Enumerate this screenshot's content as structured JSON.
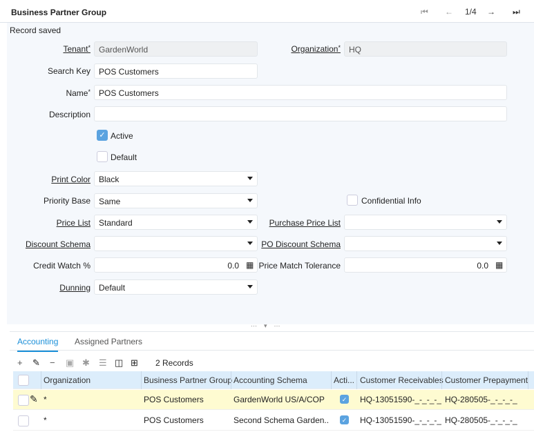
{
  "header": {
    "title": "Business Partner Group",
    "record_position": "1/4"
  },
  "status": "Record saved",
  "form": {
    "tenant": {
      "label": "Tenant",
      "value": "GardenWorld"
    },
    "organization": {
      "label": "Organization",
      "value": "HQ"
    },
    "search_key": {
      "label": "Search Key",
      "value": "POS Customers"
    },
    "name": {
      "label": "Name",
      "value": "POS Customers"
    },
    "description": {
      "label": "Description",
      "value": ""
    },
    "active": {
      "label": "Active",
      "checked": true
    },
    "default": {
      "label": "Default",
      "checked": false
    },
    "print_color": {
      "label": "Print Color",
      "value": "Black"
    },
    "priority_base": {
      "label": "Priority Base",
      "value": "Same"
    },
    "confidential_info": {
      "label": "Confidential Info",
      "checked": false
    },
    "price_list": {
      "label": "Price List",
      "value": "Standard"
    },
    "purchase_price_list": {
      "label": "Purchase Price List",
      "value": ""
    },
    "discount_schema": {
      "label": "Discount Schema",
      "value": ""
    },
    "po_discount_schema": {
      "label": "PO Discount Schema",
      "value": ""
    },
    "credit_watch": {
      "label": "Credit Watch %",
      "value": "0.0"
    },
    "price_match_tolerance": {
      "label": "Price Match Tolerance",
      "value": "0.0"
    },
    "dunning": {
      "label": "Dunning",
      "value": "Default"
    },
    "required_mark": "*"
  },
  "tabs": [
    {
      "label": "Accounting"
    },
    {
      "label": "Assigned Partners"
    }
  ],
  "toolbar": {
    "record_count": "2 Records"
  },
  "grid": {
    "columns": [
      "Organization",
      "Business Partner Group",
      "Accounting Schema",
      "Acti...",
      "Customer Receivables",
      "Customer Prepayment"
    ],
    "rows": [
      {
        "organization": "*",
        "bp_group": "POS Customers",
        "schema": "GardenWorld US/A/COP",
        "active": true,
        "receivables": "HQ-13051590-_-_-_-_",
        "prepayment": "HQ-280505-_-_-_-_"
      },
      {
        "organization": "*",
        "bp_group": "POS Customers",
        "schema": "Second Schema Garden...",
        "active": true,
        "receivables": "HQ-13051590-_-_-_-_",
        "prepayment": "HQ-280505-_-_-_-_"
      }
    ]
  }
}
